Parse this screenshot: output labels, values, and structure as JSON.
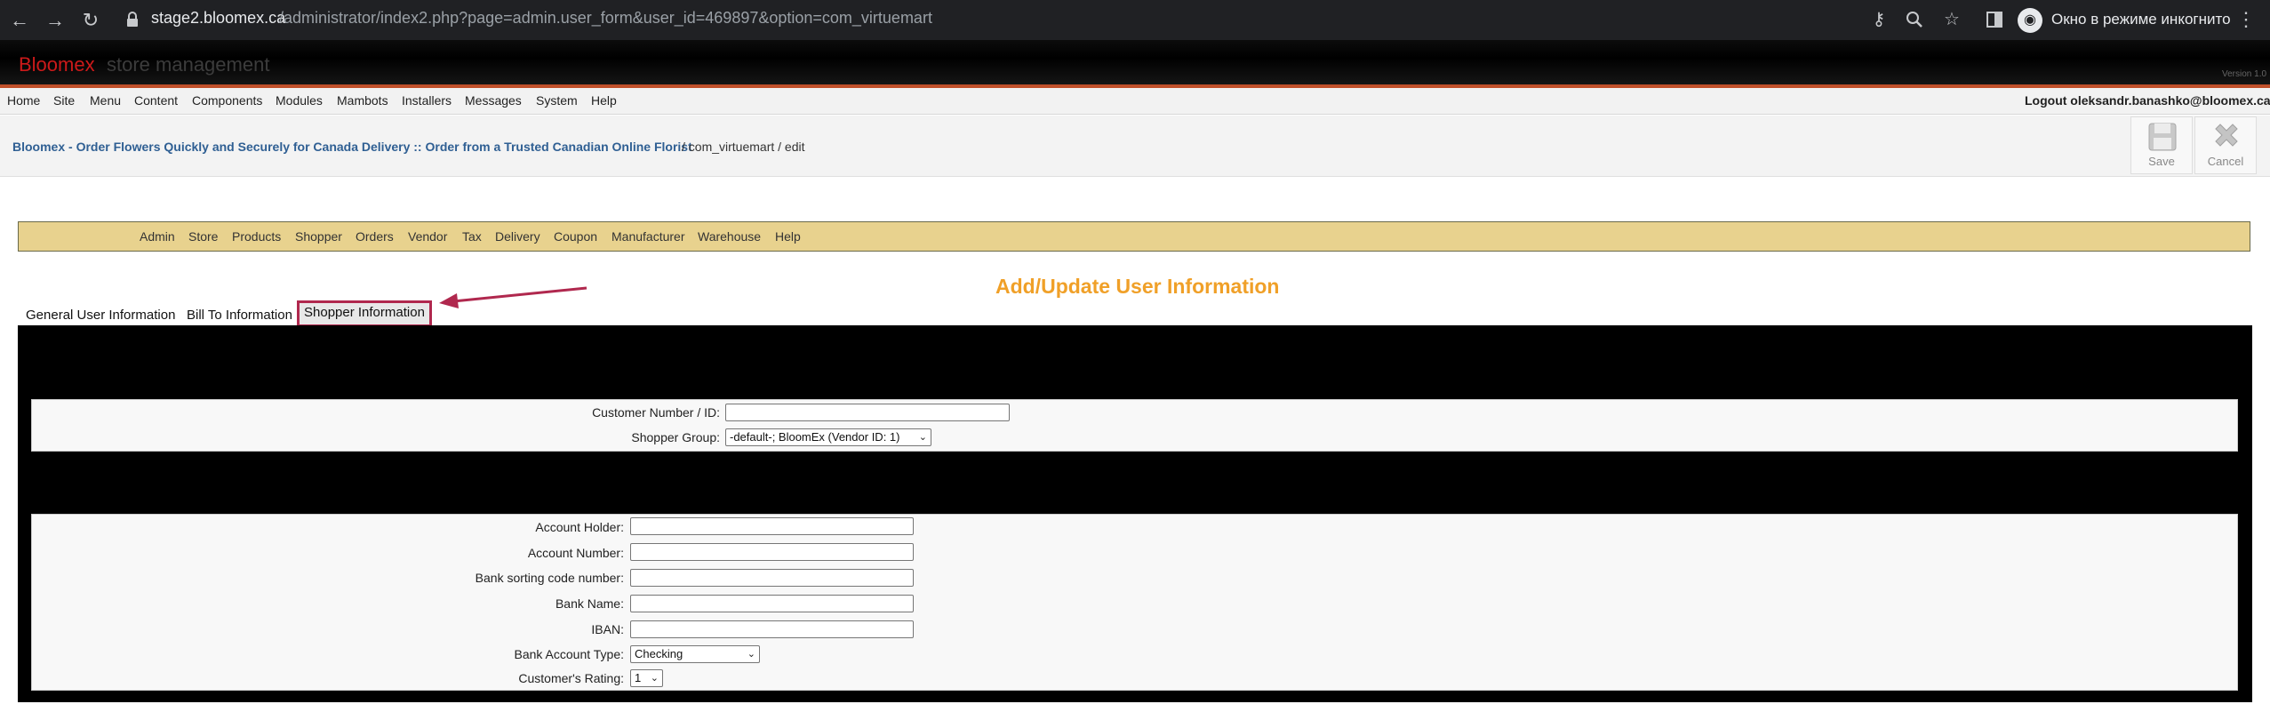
{
  "browser": {
    "url_domain": "stage2.bloomex.ca",
    "url_path": "/administrator/index2.php?page=admin.user_form&user_id=469897&option=com_virtuemart",
    "incognito_label": "Окно в режиме инкогнито",
    "icons": [
      "back-icon",
      "forward-icon",
      "reload-icon",
      "lock-icon",
      "key-icon",
      "zoom-icon",
      "star-icon",
      "sidepanel-icon",
      "incognito-icon",
      "menu-dots-icon"
    ]
  },
  "header": {
    "brand_red": "Bloomex",
    "brand_grey": "store management",
    "version": "Version 1.0"
  },
  "topmenu": {
    "items": [
      "Home",
      "Site",
      "Menu",
      "Content",
      "Components",
      "Modules",
      "Mambots",
      "Installers",
      "Messages",
      "System",
      "Help"
    ],
    "logout": "Logout oleksandr.banashko@bloomex.ca"
  },
  "pathway": {
    "site": "Bloomex - Order Flowers Quickly and Securely for Canada Delivery :: Order from a Trusted Canadian Online Florist",
    "rest": "/ com_virtuemart / edit"
  },
  "toolbar": {
    "save_label": "Save",
    "cancel_label": "Cancel"
  },
  "vm_menu": {
    "items": [
      "Admin",
      "Store",
      "Products",
      "Shopper",
      "Orders",
      "Vendor",
      "Tax",
      "Delivery",
      "Coupon",
      "Manufacturer",
      "Warehouse",
      "Help"
    ]
  },
  "page_heading": "Add/Update User Information",
  "tabs": [
    "General User Information",
    "Bill To Information",
    "Shopper Information"
  ],
  "shopper_form": {
    "customer_number_label": "Customer Number / ID:",
    "customer_number_value": "",
    "shopper_group_label": "Shopper Group:",
    "shopper_group_value": "-default-; BloomEx (Vendor ID: 1)"
  },
  "bank_form": {
    "account_holder_label": "Account Holder:",
    "account_number_label": "Account Number:",
    "sorting_code_label": "Bank sorting code number:",
    "bank_name_label": "Bank Name:",
    "iban_label": "IBAN:",
    "account_type_label": "Bank Account Type:",
    "account_type_value": "Checking",
    "rating_label": "Customer's Rating:",
    "rating_value": "1"
  },
  "colors": {
    "accent_orange": "#f0a028",
    "vm_menu_bg": "#e8d28e",
    "annotation": "#b0284e",
    "link_blue": "#2f5f93"
  }
}
